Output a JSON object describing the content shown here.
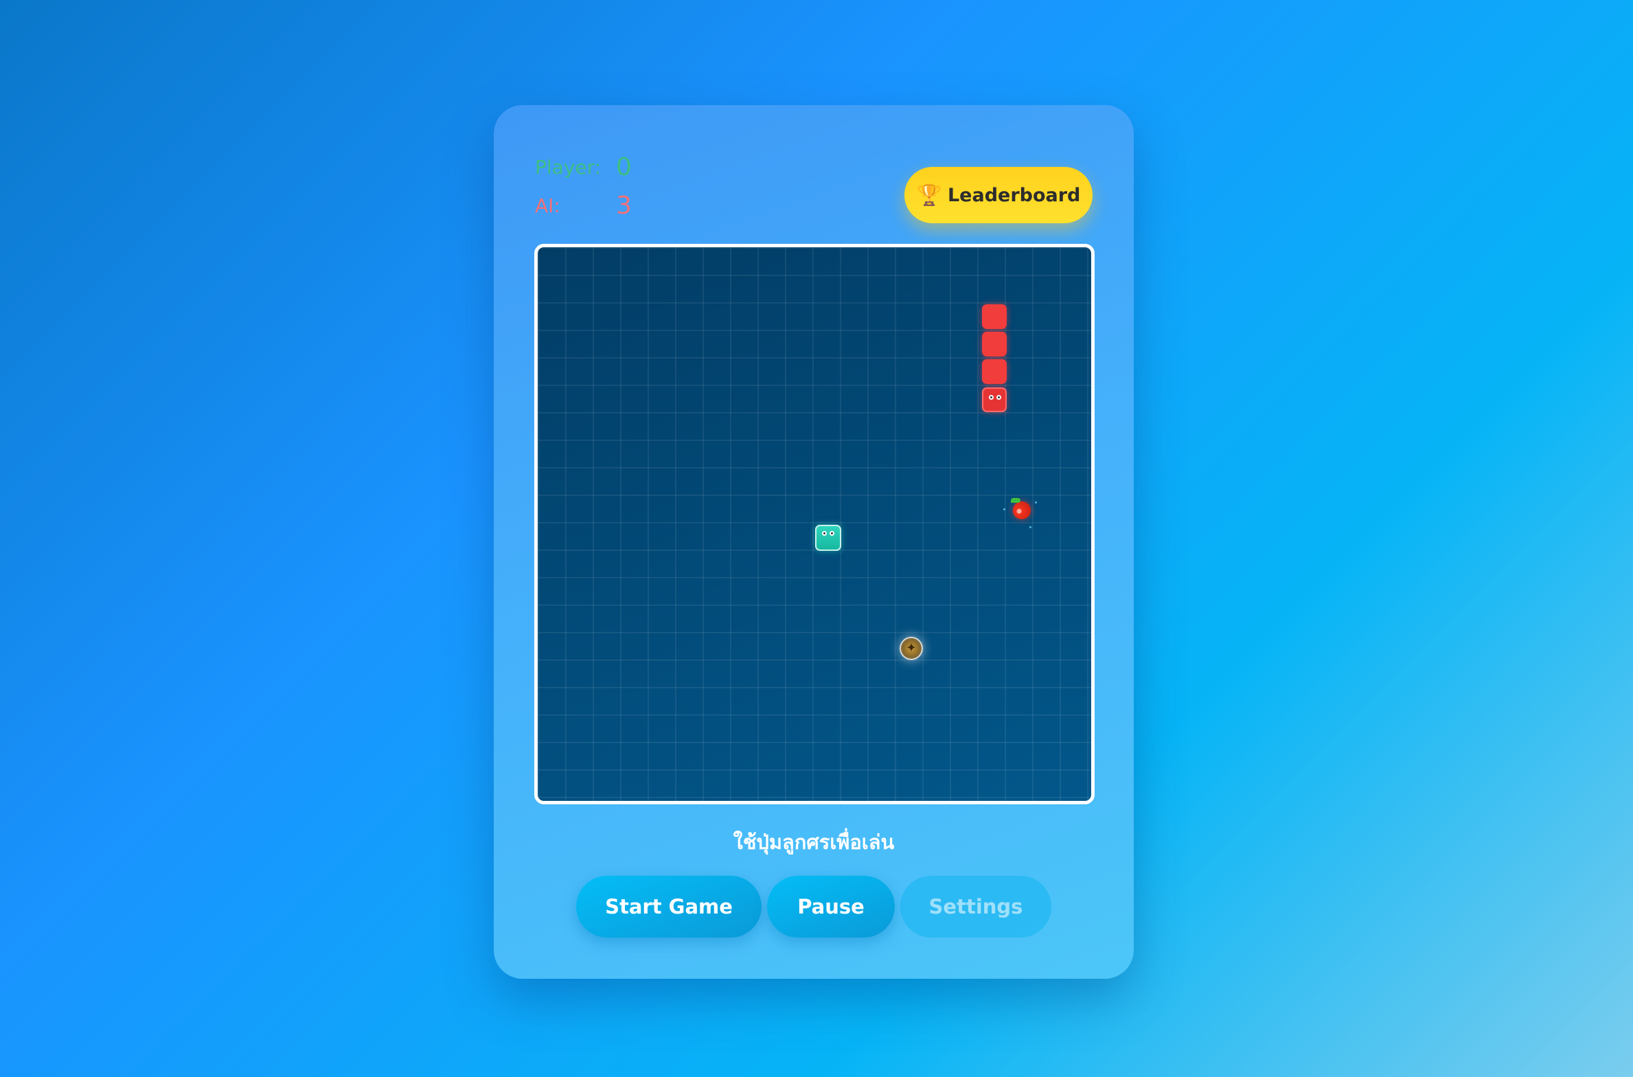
{
  "scores": {
    "player_label": "Player:",
    "player_value": "0",
    "ai_label": "AI:",
    "ai_value": "3"
  },
  "leaderboard": {
    "icon": "trophy-icon",
    "label": "Leaderboard"
  },
  "board": {
    "grid_columns": 20,
    "grid_rows": 20,
    "ai_snake": {
      "color": "#f23d3d",
      "segments": [
        [
          16,
          2
        ],
        [
          16,
          3
        ],
        [
          16,
          4
        ],
        [
          16,
          5
        ]
      ],
      "head": [
        16,
        5
      ]
    },
    "player_snake": {
      "color": "#1ec9ae",
      "segments": [
        [
          10,
          10
        ]
      ],
      "head": [
        10,
        10
      ]
    },
    "food": {
      "icon": "apple-icon",
      "cell": [
        17,
        9
      ]
    },
    "powerup": {
      "icon": "powerup-orb-icon",
      "cell": [
        13,
        14
      ]
    }
  },
  "hint": "ใช้ปุ่มลูกศรเพื่อเล่น",
  "controls": {
    "start_label": "Start Game",
    "pause_label": "Pause",
    "settings_label": "Settings"
  }
}
